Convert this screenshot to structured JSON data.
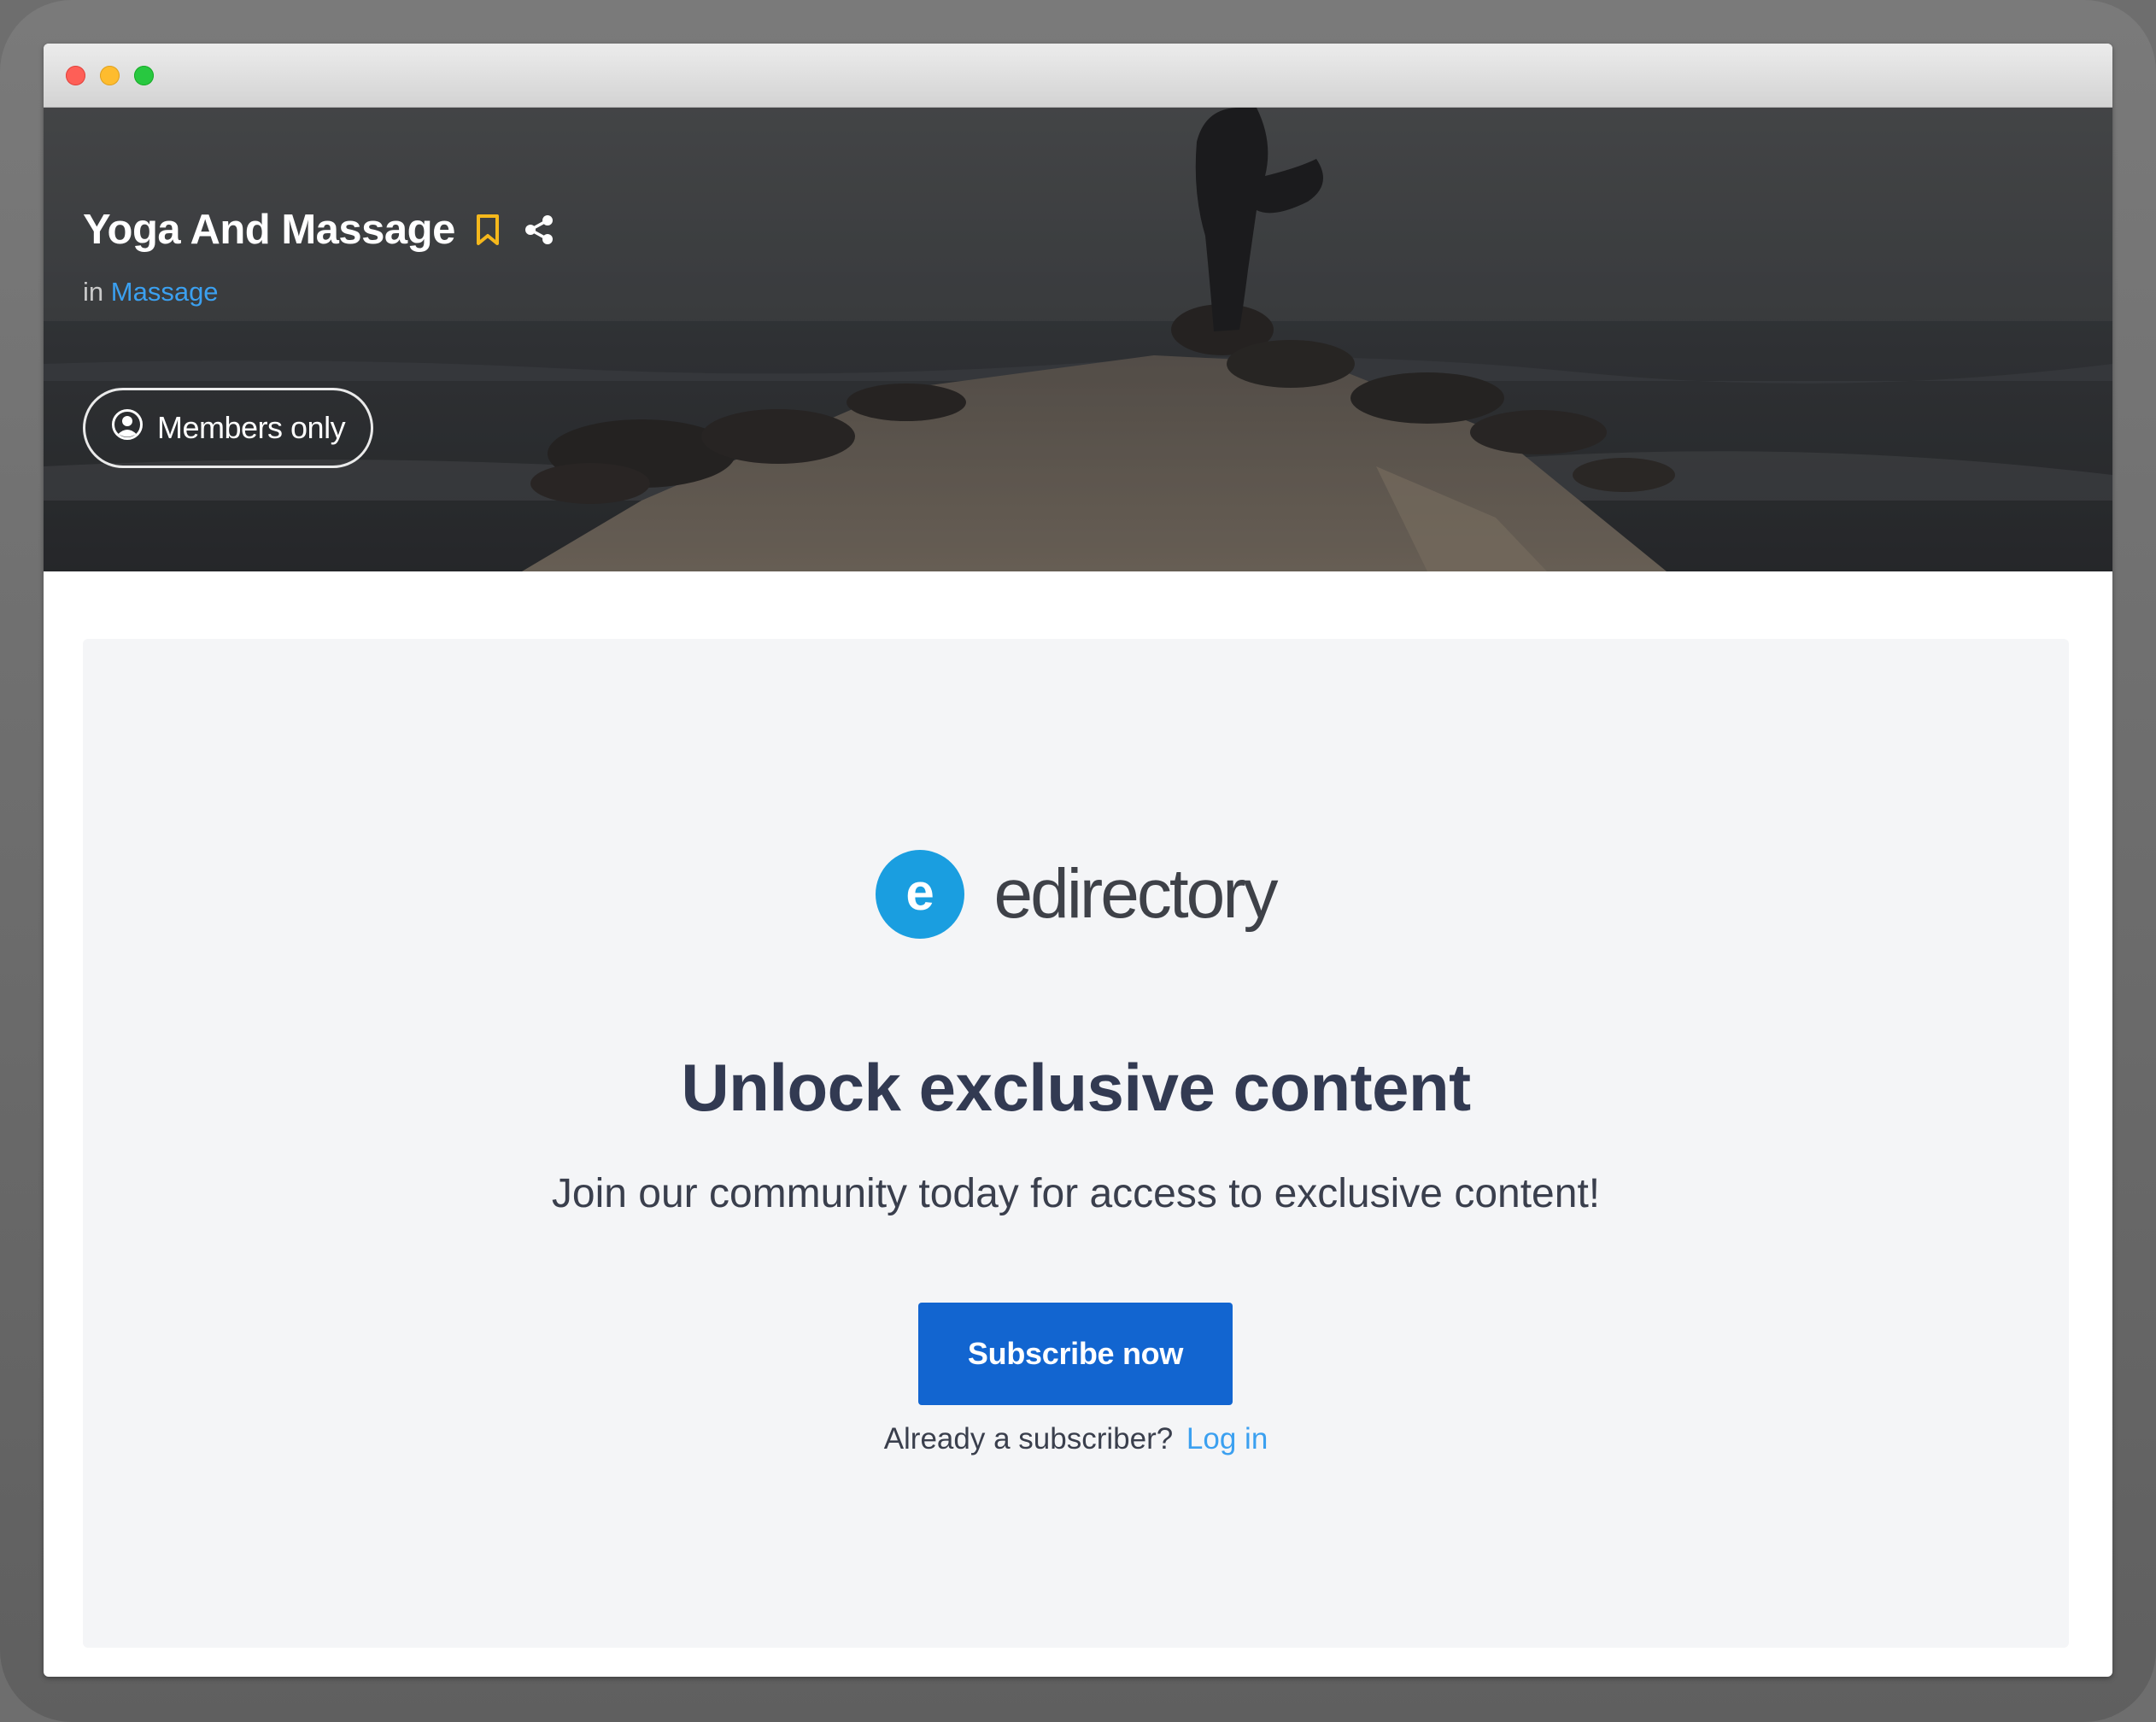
{
  "listing": {
    "title": "Yoga And Massage",
    "category_prefix": "in",
    "category": "Massage",
    "badge": "Members only"
  },
  "paywall": {
    "brand_name": "edirectory",
    "brand_mark_letter": "e",
    "headline": "Unlock exclusive content",
    "subtext": "Join our community today for access to exclusive content!",
    "subscribe_label": "Subscribe now",
    "login_prompt": "Already a subscriber?",
    "login_label": "Log in"
  },
  "icons": {
    "bookmark": "bookmark-icon",
    "share": "share-icon",
    "user": "user-circle-icon"
  },
  "colors": {
    "accent_link": "#3ba0f0",
    "bookmark_yellow": "#f5b81c",
    "primary_button": "#1265d0",
    "brand_mark": "#1a9ee0",
    "headline_text": "#323a52",
    "panel_background": "#f4f5f7"
  }
}
